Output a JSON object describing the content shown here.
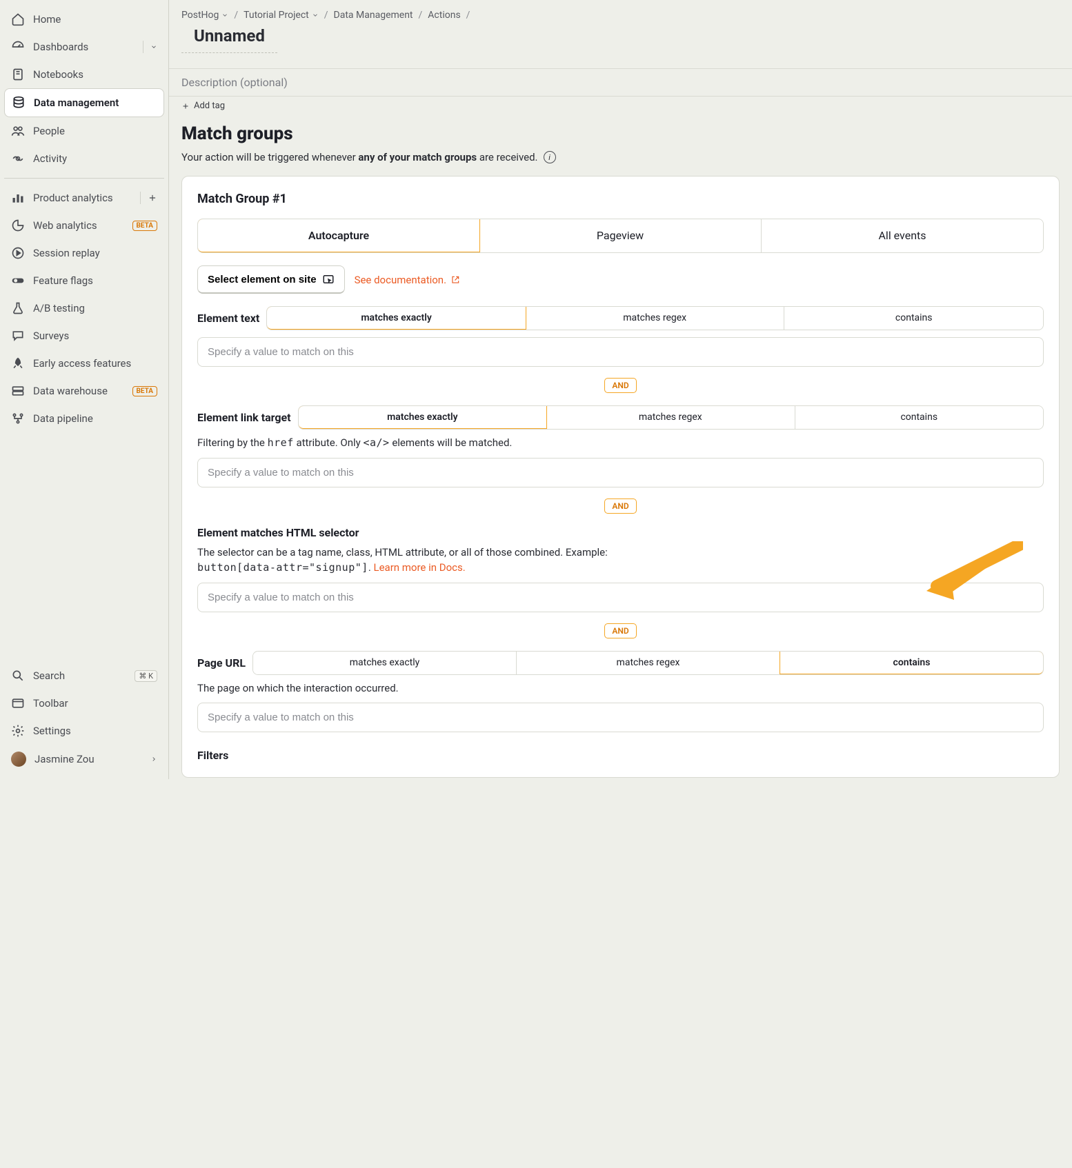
{
  "sidebar": {
    "items": [
      {
        "label": "Home"
      },
      {
        "label": "Dashboards"
      },
      {
        "label": "Notebooks"
      },
      {
        "label": "Data management"
      },
      {
        "label": "People"
      },
      {
        "label": "Activity"
      }
    ],
    "analytics": [
      {
        "label": "Product analytics"
      },
      {
        "label": "Web analytics",
        "badge": "BETA"
      },
      {
        "label": "Session replay"
      },
      {
        "label": "Feature flags"
      },
      {
        "label": "A/B testing"
      },
      {
        "label": "Surveys"
      },
      {
        "label": "Early access features"
      },
      {
        "label": "Data warehouse",
        "badge": "BETA"
      },
      {
        "label": "Data pipeline"
      }
    ],
    "bottom": {
      "search": "Search",
      "search_kbd": "⌘ K",
      "toolbar": "Toolbar",
      "settings": "Settings",
      "user": "Jasmine Zou"
    }
  },
  "breadcrumbs": [
    "PostHog",
    "Tutorial Project",
    "Data Management",
    "Actions"
  ],
  "page_title": "Unnamed",
  "description_placeholder": "Description (optional)",
  "add_tag": "Add tag",
  "heading": "Match groups",
  "sub_prefix": "Your action will be triggered whenever ",
  "sub_bold": "any of your match groups",
  "sub_suffix": " are received.",
  "group": {
    "title": "Match Group #1",
    "tabs": [
      "Autocapture",
      "Pageview",
      "All events"
    ],
    "active_tab": 0,
    "select_element": "Select element on site",
    "docs_link": "See documentation.",
    "and": "AND",
    "match_modes": [
      "matches exactly",
      "matches regex",
      "contains"
    ],
    "input_placeholder": "Specify a value to match on this",
    "element_text": {
      "label": "Element text",
      "active": 0
    },
    "element_link": {
      "label": "Element link target",
      "active": 0,
      "help_prefix": "Filtering by the ",
      "help_code1": "href",
      "help_mid": " attribute. Only ",
      "help_code2": "<a/>",
      "help_suffix": " elements will be matched."
    },
    "selector": {
      "label": "Element matches HTML selector",
      "help_prefix": "The selector can be a tag name, class, HTML attribute, or all of those combined. Example: ",
      "help_code": "button[data-attr=\"signup\"]",
      "help_suffix": ". ",
      "learn": "Learn more in Docs."
    },
    "page_url": {
      "label": "Page URL",
      "active": 2,
      "help": "The page on which the interaction occurred."
    },
    "filters": "Filters"
  }
}
